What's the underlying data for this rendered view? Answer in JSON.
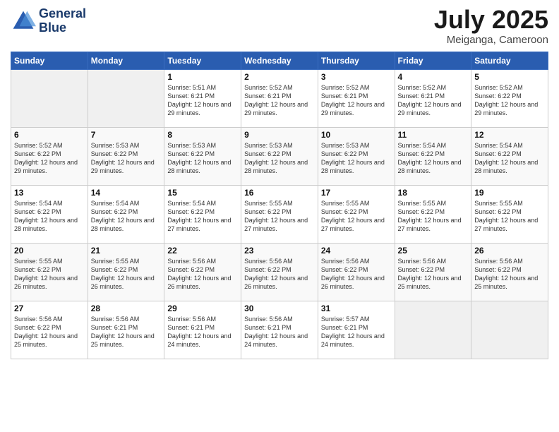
{
  "header": {
    "logo_line1": "General",
    "logo_line2": "Blue",
    "month_title": "July 2025",
    "location": "Meiganga, Cameroon"
  },
  "weekdays": [
    "Sunday",
    "Monday",
    "Tuesday",
    "Wednesday",
    "Thursday",
    "Friday",
    "Saturday"
  ],
  "weeks": [
    [
      {
        "day": "",
        "empty": true
      },
      {
        "day": "",
        "empty": true
      },
      {
        "day": "1",
        "info": "Sunrise: 5:51 AM\nSunset: 6:21 PM\nDaylight: 12 hours and 29 minutes."
      },
      {
        "day": "2",
        "info": "Sunrise: 5:52 AM\nSunset: 6:21 PM\nDaylight: 12 hours and 29 minutes."
      },
      {
        "day": "3",
        "info": "Sunrise: 5:52 AM\nSunset: 6:21 PM\nDaylight: 12 hours and 29 minutes."
      },
      {
        "day": "4",
        "info": "Sunrise: 5:52 AM\nSunset: 6:21 PM\nDaylight: 12 hours and 29 minutes."
      },
      {
        "day": "5",
        "info": "Sunrise: 5:52 AM\nSunset: 6:22 PM\nDaylight: 12 hours and 29 minutes."
      }
    ],
    [
      {
        "day": "6",
        "info": "Sunrise: 5:52 AM\nSunset: 6:22 PM\nDaylight: 12 hours and 29 minutes."
      },
      {
        "day": "7",
        "info": "Sunrise: 5:53 AM\nSunset: 6:22 PM\nDaylight: 12 hours and 29 minutes."
      },
      {
        "day": "8",
        "info": "Sunrise: 5:53 AM\nSunset: 6:22 PM\nDaylight: 12 hours and 28 minutes."
      },
      {
        "day": "9",
        "info": "Sunrise: 5:53 AM\nSunset: 6:22 PM\nDaylight: 12 hours and 28 minutes."
      },
      {
        "day": "10",
        "info": "Sunrise: 5:53 AM\nSunset: 6:22 PM\nDaylight: 12 hours and 28 minutes."
      },
      {
        "day": "11",
        "info": "Sunrise: 5:54 AM\nSunset: 6:22 PM\nDaylight: 12 hours and 28 minutes."
      },
      {
        "day": "12",
        "info": "Sunrise: 5:54 AM\nSunset: 6:22 PM\nDaylight: 12 hours and 28 minutes."
      }
    ],
    [
      {
        "day": "13",
        "info": "Sunrise: 5:54 AM\nSunset: 6:22 PM\nDaylight: 12 hours and 28 minutes."
      },
      {
        "day": "14",
        "info": "Sunrise: 5:54 AM\nSunset: 6:22 PM\nDaylight: 12 hours and 28 minutes."
      },
      {
        "day": "15",
        "info": "Sunrise: 5:54 AM\nSunset: 6:22 PM\nDaylight: 12 hours and 27 minutes."
      },
      {
        "day": "16",
        "info": "Sunrise: 5:55 AM\nSunset: 6:22 PM\nDaylight: 12 hours and 27 minutes."
      },
      {
        "day": "17",
        "info": "Sunrise: 5:55 AM\nSunset: 6:22 PM\nDaylight: 12 hours and 27 minutes."
      },
      {
        "day": "18",
        "info": "Sunrise: 5:55 AM\nSunset: 6:22 PM\nDaylight: 12 hours and 27 minutes."
      },
      {
        "day": "19",
        "info": "Sunrise: 5:55 AM\nSunset: 6:22 PM\nDaylight: 12 hours and 27 minutes."
      }
    ],
    [
      {
        "day": "20",
        "info": "Sunrise: 5:55 AM\nSunset: 6:22 PM\nDaylight: 12 hours and 26 minutes."
      },
      {
        "day": "21",
        "info": "Sunrise: 5:55 AM\nSunset: 6:22 PM\nDaylight: 12 hours and 26 minutes."
      },
      {
        "day": "22",
        "info": "Sunrise: 5:56 AM\nSunset: 6:22 PM\nDaylight: 12 hours and 26 minutes."
      },
      {
        "day": "23",
        "info": "Sunrise: 5:56 AM\nSunset: 6:22 PM\nDaylight: 12 hours and 26 minutes."
      },
      {
        "day": "24",
        "info": "Sunrise: 5:56 AM\nSunset: 6:22 PM\nDaylight: 12 hours and 26 minutes."
      },
      {
        "day": "25",
        "info": "Sunrise: 5:56 AM\nSunset: 6:22 PM\nDaylight: 12 hours and 25 minutes."
      },
      {
        "day": "26",
        "info": "Sunrise: 5:56 AM\nSunset: 6:22 PM\nDaylight: 12 hours and 25 minutes."
      }
    ],
    [
      {
        "day": "27",
        "info": "Sunrise: 5:56 AM\nSunset: 6:22 PM\nDaylight: 12 hours and 25 minutes."
      },
      {
        "day": "28",
        "info": "Sunrise: 5:56 AM\nSunset: 6:21 PM\nDaylight: 12 hours and 25 minutes."
      },
      {
        "day": "29",
        "info": "Sunrise: 5:56 AM\nSunset: 6:21 PM\nDaylight: 12 hours and 24 minutes."
      },
      {
        "day": "30",
        "info": "Sunrise: 5:56 AM\nSunset: 6:21 PM\nDaylight: 12 hours and 24 minutes."
      },
      {
        "day": "31",
        "info": "Sunrise: 5:57 AM\nSunset: 6:21 PM\nDaylight: 12 hours and 24 minutes."
      },
      {
        "day": "",
        "empty": true
      },
      {
        "day": "",
        "empty": true
      }
    ]
  ]
}
